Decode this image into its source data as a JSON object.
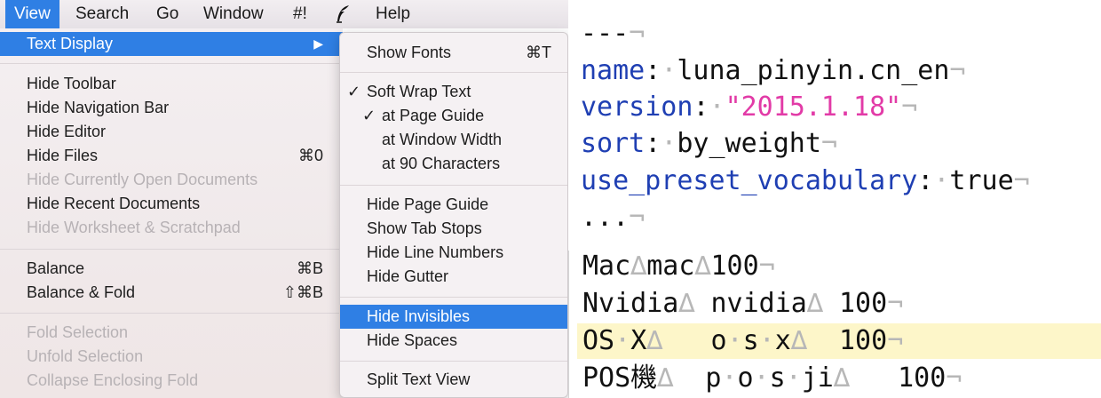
{
  "menubar": {
    "items": [
      "View",
      "Search",
      "Go",
      "Window",
      "#!",
      "Help"
    ],
    "logo_icon": "feather-quill-icon",
    "active_index": 0
  },
  "view_menu": {
    "items": [
      {
        "label": "Text Display",
        "submenu_arrow": "▶",
        "highlighted": true
      },
      {
        "label": "Hide Toolbar"
      },
      {
        "label": "Hide Navigation Bar"
      },
      {
        "label": "Hide Editor"
      },
      {
        "label": "Hide Files",
        "shortcut": "⌘0"
      },
      {
        "label": "Hide Currently Open Documents",
        "disabled": true
      },
      {
        "label": "Hide Recent Documents"
      },
      {
        "label": "Hide Worksheet & Scratchpad",
        "disabled": true
      },
      {
        "label": "Balance",
        "shortcut": "⌘B"
      },
      {
        "label": "Balance & Fold",
        "shortcut": "⇧⌘B"
      },
      {
        "label": "Fold Selection",
        "disabled": true
      },
      {
        "label": "Unfold Selection",
        "disabled": true
      },
      {
        "label": "Collapse Enclosing Fold",
        "disabled": true
      }
    ]
  },
  "submenu": {
    "items": [
      {
        "label": "Show Fonts",
        "shortcut": "⌘T"
      },
      {
        "label": "Soft Wrap Text",
        "checked": true
      },
      {
        "label": "at Page Guide",
        "checked": true
      },
      {
        "label": "at Window Width"
      },
      {
        "label": "at 90 Characters"
      },
      {
        "label": "Hide Page Guide"
      },
      {
        "label": "Show Tab Stops"
      },
      {
        "label": "Hide Line Numbers"
      },
      {
        "label": "Hide Gutter"
      },
      {
        "label": "Hide Invisibles",
        "highlighted": true
      },
      {
        "label": "Hide Spaces"
      },
      {
        "label": "Split Text View"
      }
    ],
    "check_glyph": "✓"
  },
  "editor": {
    "line1": {
      "text": "---",
      "eol": "¬"
    },
    "line2": {
      "key": "name",
      "colon": ":",
      "dot": "·",
      "value": "luna_pinyin.cn_en",
      "eol": "¬"
    },
    "line3": {
      "key": "version",
      "colon": ":",
      "dot": "·",
      "value": "\"2015.1.18\"",
      "eol": "¬"
    },
    "line4": {
      "key": "sort",
      "colon": ":",
      "dot": "·",
      "value": "by_weight",
      "eol": "¬"
    },
    "line5": {
      "key": "use_preset_vocabulary",
      "colon": ":",
      "dot": "·",
      "value": "true",
      "eol": "¬"
    },
    "line6": {
      "text": "...",
      "eol": "¬"
    },
    "line7": {
      "a": "Mac",
      "t1": "∆",
      "b": "mac",
      "t2": "∆",
      "c": "100",
      "eol": "¬"
    },
    "line8": {
      "a": "Nvidia",
      "t1": "∆ ",
      "b": "nvidia",
      "t2": "∆ ",
      "c": "100",
      "eol": "¬"
    },
    "line9": {
      "a1": "OS",
      "d1": "·",
      "a2": "X",
      "t1": "∆   ",
      "b1": "o",
      "d2": "·",
      "b2": "s",
      "d3": "·",
      "b3": "x",
      "t2": "∆  ",
      "c": "100",
      "eol": "¬"
    },
    "line10": {
      "a": "POS機",
      "t1": "∆  ",
      "b1": "p",
      "d1": "·",
      "b2": "o",
      "d2": "·",
      "b3": "s",
      "d3": "·",
      "b4": "ji",
      "t2": "∆   ",
      "c": "100",
      "eol": "¬"
    },
    "colors": {
      "key": "#1f3fb3",
      "string": "#e23ba7",
      "invisible": "#b7b7b7",
      "current_line": "#fdf6c9"
    }
  }
}
